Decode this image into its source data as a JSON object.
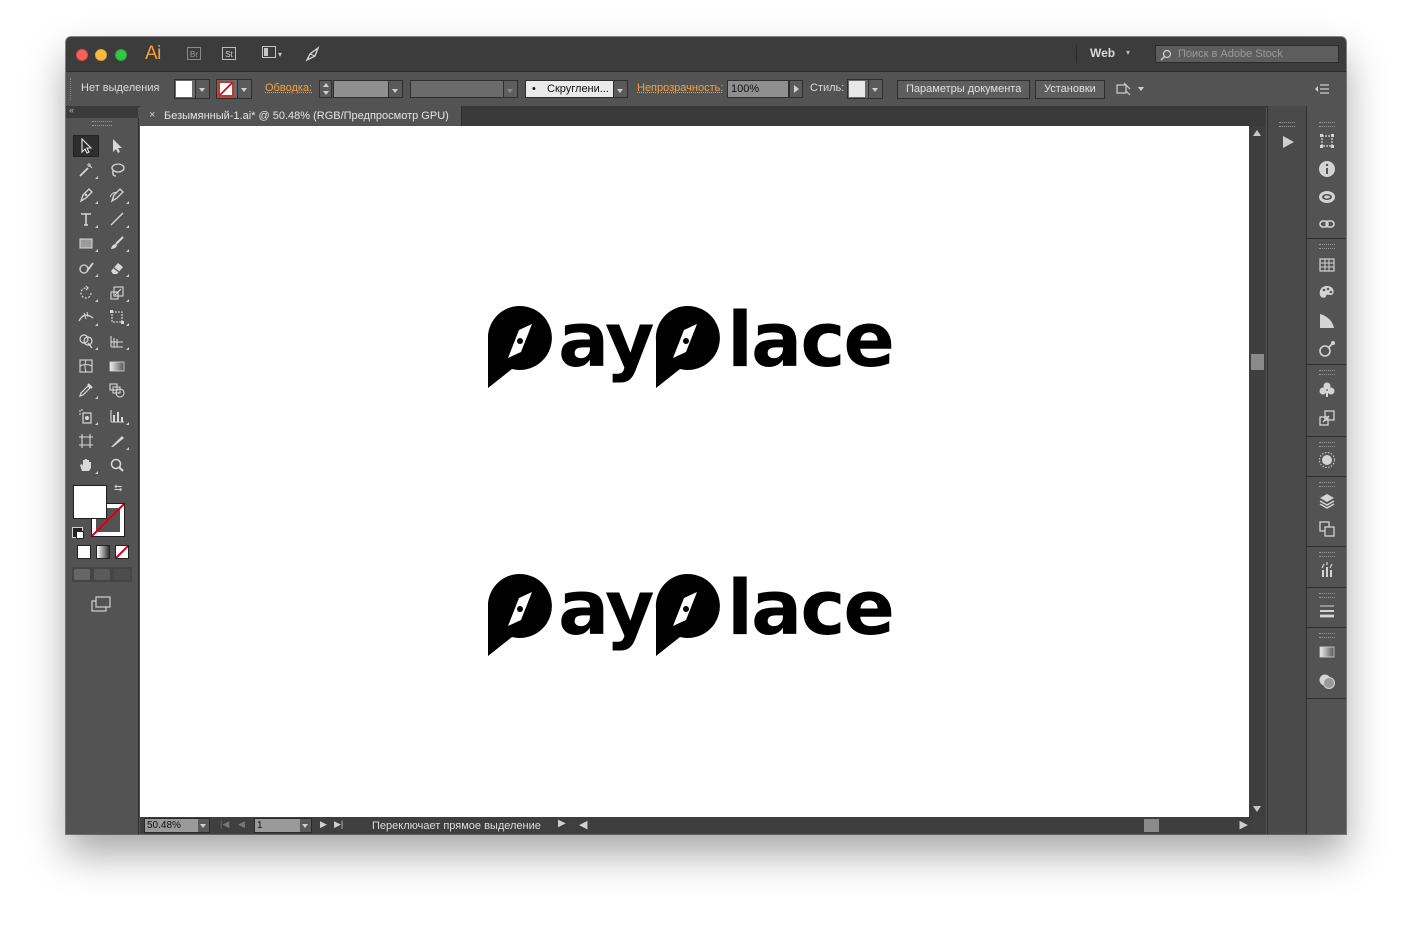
{
  "app": {
    "logo": "Ai",
    "bridge": "Br",
    "stock": "St",
    "workspace": "Web",
    "stock_search_placeholder": "Поиск в Adobe Stock"
  },
  "control_bar": {
    "selection_label": "Нет выделения",
    "stroke_label": "Обводка:",
    "corners_label": "Скруглени...",
    "opacity_label": "Непрозрачность:",
    "opacity_value": "100%",
    "style_label": "Стиль:",
    "doc_setup_button": "Параметры документа",
    "prefs_button": "Установки"
  },
  "document": {
    "tab_title": "Безымянный-1.ai* @ 50.48% (RGB/Предпросмотр GPU)",
    "logo_text": "payplace"
  },
  "status_bar": {
    "zoom": "50.48%",
    "page": "1",
    "status_text": "Переключает прямое выделение"
  },
  "colors": {
    "accent": "#f59d3b",
    "panel": "#535353",
    "titlebar": "#3c3c3c"
  }
}
